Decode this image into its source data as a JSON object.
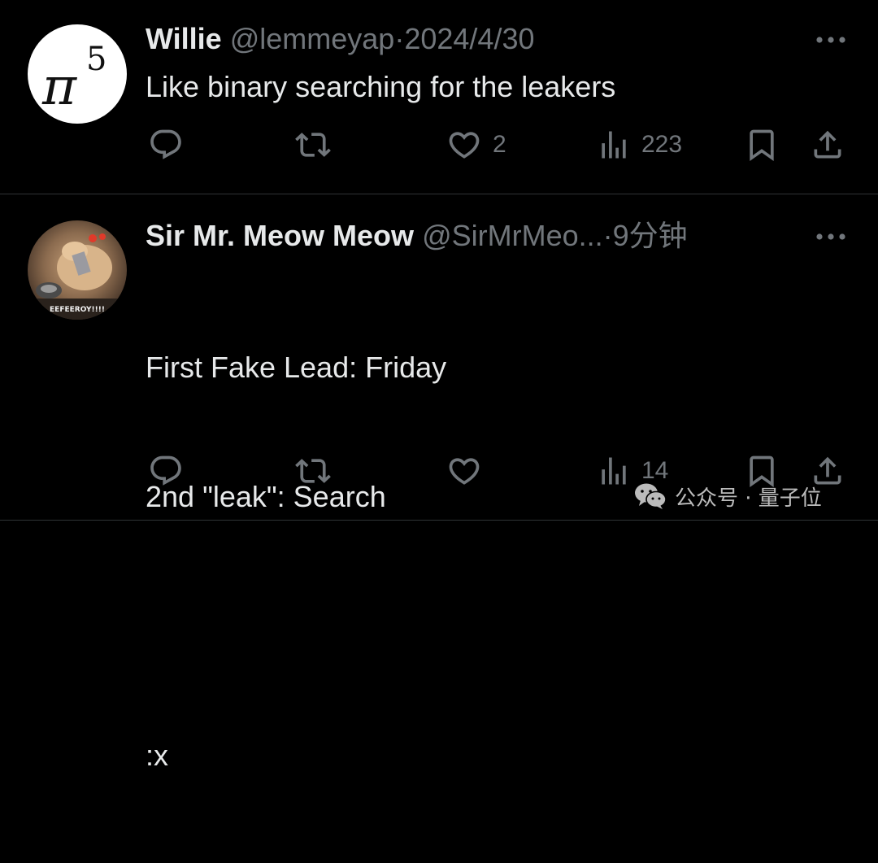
{
  "tweets": [
    {
      "author": {
        "name": "Willie",
        "handle": "@lemmeyap",
        "avatar_glyph": "π",
        "avatar_exponent": "5"
      },
      "separator": "·",
      "time": "2024/4/30",
      "text": "Like binary searching for the leakers",
      "stats": {
        "replies": "",
        "retweets": "",
        "likes": "2",
        "views": "223"
      }
    },
    {
      "author": {
        "name": "Sir Mr. Meow Meow",
        "handle": "@SirMrMeo...",
        "avatar_caption": "EEFEEROY!!!!"
      },
      "separator": "·",
      "time": "9分钟",
      "text_lines": [
        "First Fake Lead: Friday",
        "2nd \"leak\": Search",
        "",
        ":x"
      ],
      "stats": {
        "replies": "",
        "retweets": "",
        "likes": "",
        "views": "14"
      }
    }
  ],
  "icons": {
    "more": "more-horizontal-icon",
    "reply": "reply-icon",
    "retweet": "retweet-icon",
    "like": "heart-icon",
    "views": "views-chart-icon",
    "bookmark": "bookmark-icon",
    "share": "share-icon"
  },
  "watermark": {
    "text": "公众号 · 量子位",
    "icon": "wechat-icon"
  },
  "colors": {
    "background": "#000000",
    "primary_text": "#e7e9ea",
    "secondary_text": "#71767b",
    "divider": "#2f3336"
  }
}
